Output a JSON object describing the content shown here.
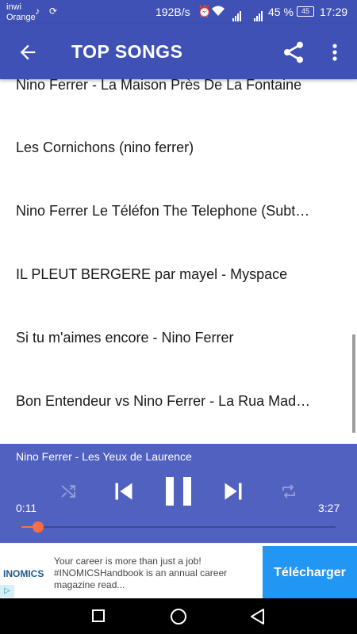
{
  "status": {
    "carrier_line1": "inwi",
    "carrier_line2": "Orange",
    "note_icon": "♪",
    "sync_icon": "⟳",
    "speed": "192B/s",
    "alarm_icon": "⏰",
    "wifi_icon": "wifi",
    "battery": "45 %",
    "battery_level": "45",
    "time": "17:29"
  },
  "appbar": {
    "title": "TOP SONGS",
    "back_icon": "arrow-back-icon",
    "share_icon": "share-icon",
    "more_icon": "more-vert-icon"
  },
  "songs": [
    "Nino Ferrer - La Maison Près De La Fontaine",
    "Les Cornichons (nino ferrer)",
    "Nino Ferrer Le Téléfon The Telephone (Subtitles)",
    "IL PLEUT BERGERE par mayel - Myspace",
    "Si tu m'aimes encore - Nino Ferrer",
    "Bon Entendeur vs Nino Ferrer - La Rua Madureira"
  ],
  "player": {
    "now_playing": "Nino Ferrer - Les Yeux de Laurence",
    "current_time": "0:11",
    "total_time": "3:27",
    "progress": 0.053,
    "accent_color": "#ff6e40"
  },
  "ad": {
    "brand": "INOMICS",
    "text": "Your career is more than just a job! #INOMICSHandbook is an annual career magazine read...",
    "cta": "Télécharger",
    "adchoice": "▷"
  }
}
